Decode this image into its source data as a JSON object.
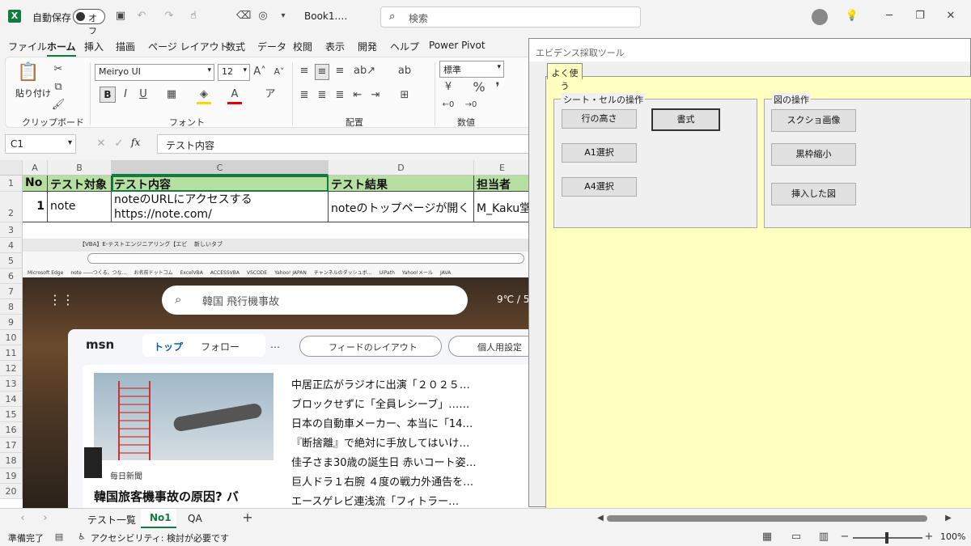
{
  "titlebar": {
    "autosave_label": "自動保存",
    "autosave_state": "オフ",
    "filename": "Book1.…",
    "search_placeholder": "検索"
  },
  "ribbon_tabs": [
    "ファイル",
    "ホーム",
    "挿入",
    "描画",
    "ページ レイアウト",
    "数式",
    "データ",
    "校閲",
    "表示",
    "開発",
    "ヘルプ",
    "Power Pivot"
  ],
  "ribbon": {
    "paste_label": "貼り付け",
    "clipboard_label": "クリップボード",
    "font_name": "Meiryo UI",
    "font_size": "12",
    "font_group_label": "フォント",
    "align_group_label": "配置",
    "number_format": "標準",
    "number_group_label": "数値",
    "bold": "B",
    "italic": "I",
    "underline": "U"
  },
  "formula": {
    "name_box": "C1",
    "fx": "fx",
    "content": "テスト内容"
  },
  "columns": [
    "A",
    "B",
    "C",
    "D",
    "E"
  ],
  "rows": [
    "1",
    "2",
    "3",
    "4",
    "5",
    "6",
    "7",
    "8",
    "9",
    "10",
    "11",
    "12",
    "13",
    "14",
    "15",
    "16",
    "17",
    "18",
    "19",
    "20"
  ],
  "table": {
    "headers": [
      "No",
      "テスト対象",
      "テスト内容",
      "テスト結果",
      "担当者"
    ],
    "row": {
      "no": "1",
      "target": "note",
      "content_line1": "noteのURLにアクセスする",
      "content_line2": "https://note.com/",
      "result": "noteのトップページが開く",
      "owner": "M_Kaku堂"
    }
  },
  "screenshot": {
    "browser_tab": "【VBA】E-テストエンジニアリング【エビ",
    "new_tab": "新しいタブ",
    "bookmarks": [
      "Microsoft Edge",
      "note ――つくる、つな…",
      "お名前ドットコム",
      "ExcelVBA",
      "ACCESSVBA",
      "VSCODE",
      "Yahoo! JAPAN",
      "チャンネルのダッシュボ…",
      "UiPath",
      "Yahoo!メール",
      "JAVA"
    ],
    "search_text": "韓国 飛行機事故",
    "weather": "9℃ / 5",
    "msn_logo": "msn",
    "nav": [
      "トップ",
      "フォロー",
      "…"
    ],
    "feed_layout": "フィードのレイアウト",
    "personal": "個人用設定",
    "headlines": [
      "中居正広がラジオに出演「２０２５…",
      "ブロックせずに「全員レシーブ」……",
      "日本の自動車メーカー、本当に「14…",
      "『断捨離』で絶対に手放してはいけ…",
      "佳子さま30歳の誕生日 赤いコート姿…",
      "巨人ドラ１右腕 ４度の戦力外通告を…",
      "エースゲレビ連浅流「フィトラー…"
    ],
    "source": "毎日新聞",
    "main_headline": "韓国旅客機事故の原因? バ"
  },
  "sheet_tabs": [
    "テスト一覧",
    "No1",
    "QA"
  ],
  "status": {
    "ready": "準備完了",
    "accessibility": "アクセシビリティ: 検討が必要です",
    "zoom": "100%"
  },
  "dialog": {
    "title": "エビデンス採取ツール",
    "tab": "よく使う",
    "group_left": "シート・セルの操作",
    "group_right": "図の操作",
    "btn_row_height": "行の高さ",
    "btn_format": "書式",
    "btn_a1": "A1選択",
    "btn_a4": "A4選択",
    "btn_screenshot": "スクショ画像",
    "btn_shrink": "黒枠縮小",
    "btn_inserted": "挿入した図"
  }
}
